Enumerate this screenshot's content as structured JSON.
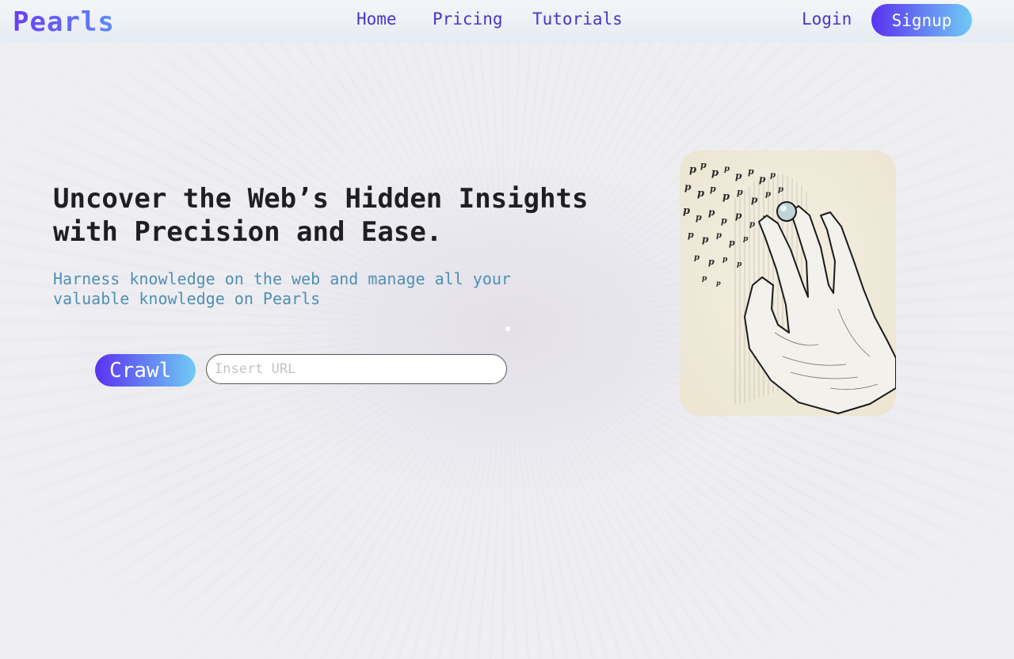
{
  "brand": {
    "logo": "Pearls"
  },
  "nav": {
    "items": [
      "Home",
      "Pricing",
      "Tutorials"
    ]
  },
  "auth": {
    "login": "Login",
    "signup": "Signup"
  },
  "hero": {
    "headline": "Uncover the Web’s Hidden Insights with Precision and Ease.",
    "subhead": "Harness knowledge on the web and manage all your valuable knowledge on Pearls",
    "crawl_label": "Crawl",
    "url_placeholder": "Insert URL",
    "url_value": ""
  },
  "illustration": {
    "icon": "hand-holding-pearl-icon"
  },
  "colors": {
    "brand_purple": "#5a32f2",
    "brand_cyan": "#6fcbf4",
    "nav_text": "#4a34c9",
    "subhead_text": "#4f8fb4"
  }
}
